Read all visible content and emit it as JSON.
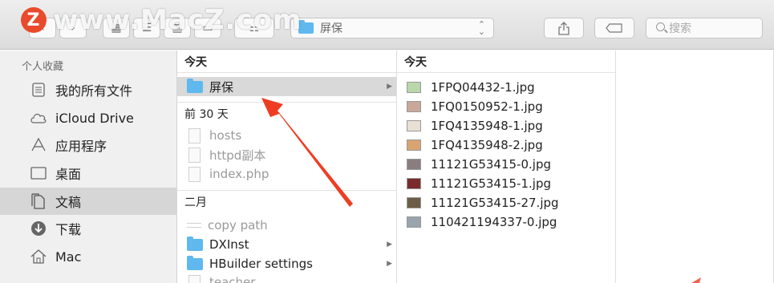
{
  "watermark": {
    "badge": "Z",
    "text": "www.MacZ.com"
  },
  "toolbar": {
    "path_popup": {
      "label": "屏保"
    },
    "search": {
      "placeholder": "搜索"
    }
  },
  "sidebar": {
    "heading": "个人收藏",
    "items": [
      {
        "label": "我的所有文件",
        "icon": "all-files-icon"
      },
      {
        "label": "iCloud Drive",
        "icon": "cloud-icon"
      },
      {
        "label": "应用程序",
        "icon": "applications-icon"
      },
      {
        "label": "桌面",
        "icon": "desktop-icon"
      },
      {
        "label": "文稿",
        "icon": "documents-icon",
        "selected": true
      },
      {
        "label": "下载",
        "icon": "downloads-icon"
      },
      {
        "label": "Mac",
        "icon": "home-icon"
      }
    ]
  },
  "column1": {
    "group_today": "今天",
    "today_items": [
      {
        "label": "屏保",
        "type": "folder",
        "selected": true
      }
    ],
    "group_30days": "前 30 天",
    "days_items": [
      {
        "label": "hosts",
        "type": "doc"
      },
      {
        "label": "httpd副本",
        "type": "doc"
      },
      {
        "label": "index.php",
        "type": "doc"
      }
    ],
    "group_feb": "二月",
    "feb_items": [
      {
        "label": "copy path",
        "type": "alias"
      },
      {
        "label": "DXInst",
        "type": "folder"
      },
      {
        "label": "HBuilder settings",
        "type": "folder"
      },
      {
        "label": "teacher",
        "type": "doc"
      }
    ]
  },
  "column2": {
    "group_today": "今天",
    "files": [
      {
        "label": "1FPQ04432-1.jpg",
        "thumb": "#b9d7a8"
      },
      {
        "label": "1FQ0150952-1.jpg",
        "thumb": "#c9a89a"
      },
      {
        "label": "1FQ4135948-1.jpg",
        "thumb": "#e8e0d4"
      },
      {
        "label": "1FQ4135948-2.jpg",
        "thumb": "#d9a472"
      },
      {
        "label": "11121G53415-0.jpg",
        "thumb": "#8a7d80"
      },
      {
        "label": "11121G53415-1.jpg",
        "thumb": "#7a2c2c"
      },
      {
        "label": "11121G53415-27.jpg",
        "thumb": "#6d5d48"
      },
      {
        "label": "110421194337-0.jpg",
        "thumb": "#9aa4ad"
      }
    ]
  },
  "colors": {
    "folder": "#5fb8ee",
    "selection": "#d9d9d9",
    "arrow": "#ee3d23"
  }
}
